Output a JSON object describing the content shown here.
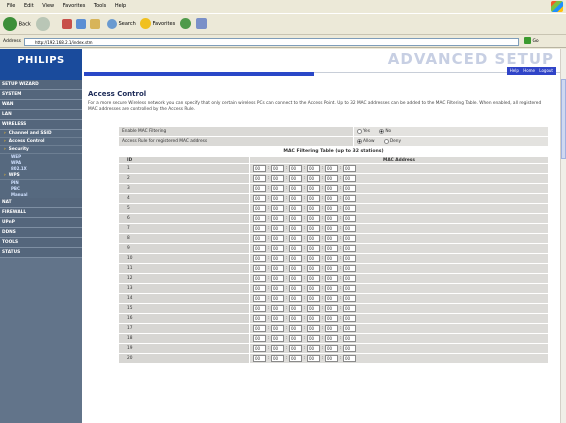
{
  "browser": {
    "menu": [
      "File",
      "Edit",
      "View",
      "Favorites",
      "Tools",
      "Help"
    ],
    "toolbar": {
      "back": "Back",
      "search": "Search",
      "favorites": "Favorites"
    },
    "address_label": "Address",
    "address_value": "http://192.168.2.1/index.stm",
    "go": "Go"
  },
  "header": {
    "brand": "PHILIPS",
    "banner": "ADVANCED SETUP",
    "links": {
      "help": "Help",
      "home": "Home",
      "logout": "Logout"
    }
  },
  "sidebar": {
    "items": [
      {
        "label": "SETUP WIZARD",
        "type": "main"
      },
      {
        "label": "SYSTEM",
        "type": "main"
      },
      {
        "label": "WAN",
        "type": "main"
      },
      {
        "label": "LAN",
        "type": "main"
      },
      {
        "label": "WIRELESS",
        "type": "main"
      },
      {
        "label": "Channel and SSID",
        "type": "sub"
      },
      {
        "label": "Access Control",
        "type": "sub"
      },
      {
        "label": "Security",
        "type": "sub"
      },
      {
        "label": "WEP",
        "type": "sub2"
      },
      {
        "label": "WPA",
        "type": "sub2"
      },
      {
        "label": "802.1X",
        "type": "sub2"
      },
      {
        "label": "WPS",
        "type": "sub"
      },
      {
        "label": "PIN",
        "type": "sub2"
      },
      {
        "label": "PBC",
        "type": "sub2"
      },
      {
        "label": "Manual",
        "type": "sub2"
      },
      {
        "label": "NAT",
        "type": "main"
      },
      {
        "label": "FIREWALL",
        "type": "main"
      },
      {
        "label": "UPnP",
        "type": "main"
      },
      {
        "label": "DDNS",
        "type": "main"
      },
      {
        "label": "TOOLS",
        "type": "main"
      },
      {
        "label": "STATUS",
        "type": "main"
      }
    ]
  },
  "content": {
    "title": "Access Control",
    "description": "For a more secure Wireless network you can specify that only certain wireless PCs can connect to the Access Point. Up to 32 MAC addresses can be added to the MAC Filtering Table. When enabled, all registered MAC addresses are controlled by the Access Rule.",
    "enable_label": "Enable MAC Filtering",
    "enable_options": {
      "yes": "Yes",
      "no": "No",
      "selected": "No"
    },
    "rule_label": "Access Rule for registered MAC address",
    "rule_options": {
      "allow": "Allow",
      "deny": "Deny",
      "selected": "Allow"
    },
    "table_title": "MAC Filtering Table (up to 32 stations)",
    "col_id": "ID",
    "col_mac": "MAC Address",
    "rows": [
      [
        "1",
        "00",
        "00",
        "00",
        "00",
        "00",
        "00"
      ],
      [
        "2",
        "00",
        "00",
        "00",
        "00",
        "00",
        "00"
      ],
      [
        "3",
        "00",
        "00",
        "00",
        "00",
        "00",
        "00"
      ],
      [
        "4",
        "00",
        "00",
        "00",
        "00",
        "00",
        "00"
      ],
      [
        "5",
        "00",
        "00",
        "00",
        "00",
        "00",
        "00"
      ],
      [
        "6",
        "00",
        "00",
        "00",
        "00",
        "00",
        "00"
      ],
      [
        "7",
        "00",
        "00",
        "00",
        "00",
        "00",
        "00"
      ],
      [
        "8",
        "00",
        "00",
        "00",
        "00",
        "00",
        "00"
      ],
      [
        "9",
        "00",
        "00",
        "00",
        "00",
        "00",
        "00"
      ],
      [
        "10",
        "00",
        "00",
        "00",
        "00",
        "00",
        "00"
      ],
      [
        "11",
        "00",
        "00",
        "00",
        "00",
        "00",
        "00"
      ],
      [
        "12",
        "00",
        "00",
        "00",
        "00",
        "00",
        "00"
      ],
      [
        "13",
        "00",
        "00",
        "00",
        "00",
        "00",
        "00"
      ],
      [
        "14",
        "00",
        "00",
        "00",
        "00",
        "00",
        "00"
      ],
      [
        "15",
        "00",
        "00",
        "00",
        "00",
        "00",
        "00"
      ],
      [
        "16",
        "00",
        "00",
        "00",
        "00",
        "00",
        "00"
      ],
      [
        "17",
        "00",
        "00",
        "00",
        "00",
        "00",
        "00"
      ],
      [
        "18",
        "00",
        "00",
        "00",
        "00",
        "00",
        "00"
      ],
      [
        "19",
        "00",
        "00",
        "00",
        "00",
        "00",
        "00"
      ],
      [
        "20",
        "00",
        "00",
        "00",
        "00",
        "00",
        "00"
      ]
    ]
  }
}
